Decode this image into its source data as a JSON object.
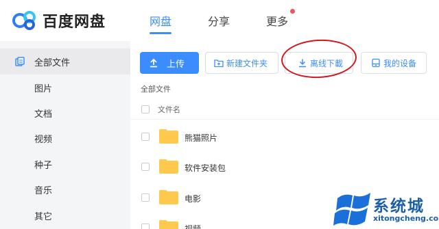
{
  "app": {
    "name": "百度网盘"
  },
  "nav": {
    "tabs": [
      {
        "label": "网盘"
      },
      {
        "label": "分享"
      },
      {
        "label": "更多"
      }
    ]
  },
  "sidebar": {
    "items": [
      {
        "label": "全部文件",
        "icon": "files-icon"
      },
      {
        "label": "图片"
      },
      {
        "label": "文档"
      },
      {
        "label": "视频"
      },
      {
        "label": "种子"
      },
      {
        "label": "音乐"
      },
      {
        "label": "其它"
      }
    ]
  },
  "toolbar": {
    "upload": "上传",
    "new_folder": "新建文件夹",
    "offline_download": "离线下載",
    "my_devices": "我的设备"
  },
  "breadcrumb": "全部文件",
  "list": {
    "column_name": "文件名",
    "rows": [
      {
        "name": "熊猫照片"
      },
      {
        "name": "软件安装包"
      },
      {
        "name": "电影"
      },
      {
        "name": "视频"
      }
    ]
  },
  "watermark": {
    "text": "系统城",
    "url": "xitongcheng.com"
  },
  "colors": {
    "accent": "#3b8cff",
    "annotation": "#d4151c",
    "folder": "#ffc94d",
    "sidebar_bg": "#f4f5f7"
  }
}
